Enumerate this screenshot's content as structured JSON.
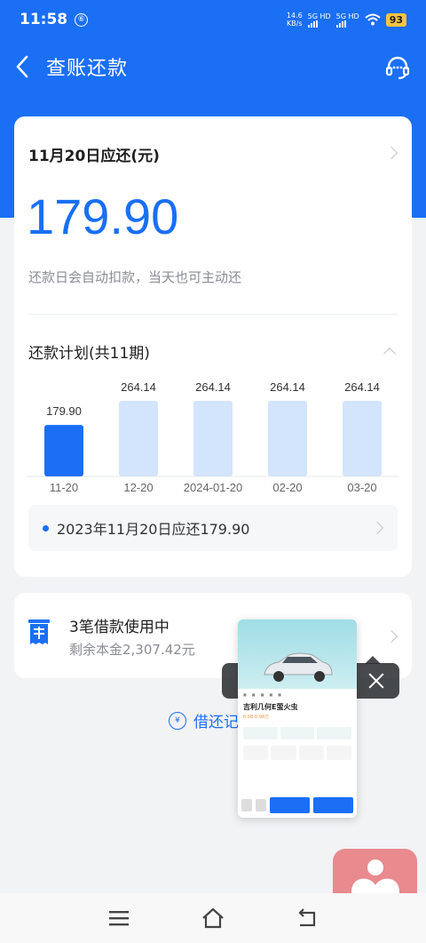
{
  "status": {
    "time": "11:58",
    "circle_glyph": "⑥",
    "net_speed": "14.6",
    "net_unit": "KB/s",
    "sim1": "5G HD",
    "sim2": "5G HD",
    "battery": "93"
  },
  "nav": {
    "title": "查账还款"
  },
  "due": {
    "title": "11月20日应还(元)",
    "amount": "179.90",
    "note": "还款日会自动扣款，当天也可主动还"
  },
  "plan": {
    "title": "还款计划(共11期)",
    "recent": "2023年11月20日应还179.90"
  },
  "chart_data": {
    "type": "bar",
    "categories": [
      "11-20",
      "12-20",
      "2024-01-20",
      "02-20",
      "03-20"
    ],
    "values": [
      179.9,
      264.14,
      264.14,
      264.14,
      264.14
    ],
    "value_labels": [
      "179.90",
      "264.14",
      "264.14",
      "264.14",
      "264.14"
    ],
    "highlight_index": 0,
    "colors": {
      "highlight": "#1a6ff5",
      "normal": "#d3e4fd"
    },
    "ylim": [
      0,
      300
    ]
  },
  "loan": {
    "title": "3笔借款使用中",
    "sub": "剩余本金2,307.42元"
  },
  "history": {
    "label": "借还记"
  },
  "preview": {
    "car_name": "吉利几何E萤火虫",
    "price": "6.98-8.98万"
  },
  "colors": {
    "brand_blue": "#1a6ff5",
    "float_button": "#e88a8e"
  }
}
